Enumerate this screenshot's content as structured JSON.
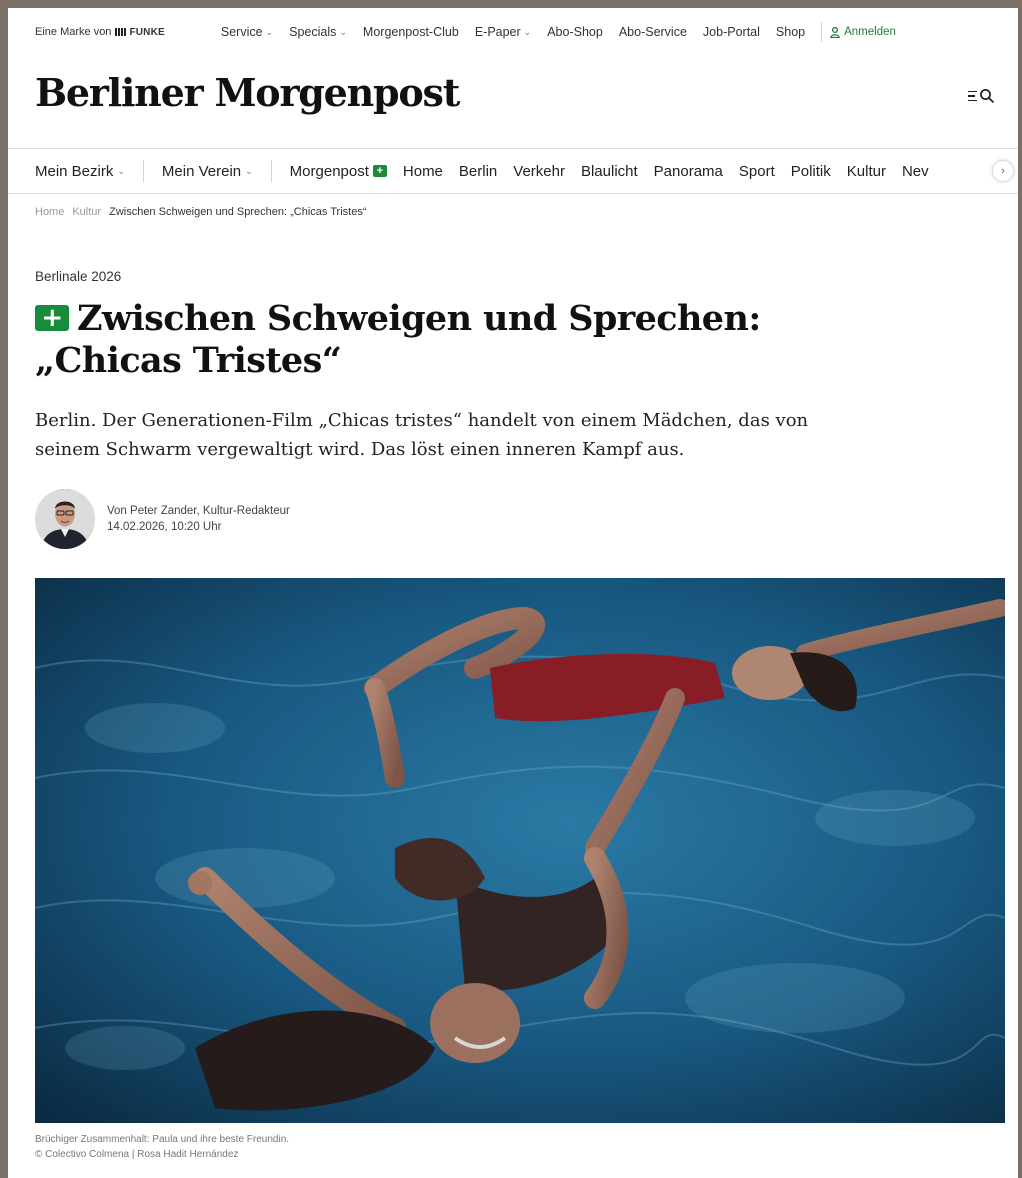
{
  "topbar": {
    "brand_note": "Eine Marke von",
    "brand_logo": "FUNKE",
    "nav": [
      {
        "label": "Service",
        "dropdown": true
      },
      {
        "label": "Specials",
        "dropdown": true
      },
      {
        "label": "Morgenpost-Club",
        "dropdown": false
      },
      {
        "label": "E-Paper",
        "dropdown": true
      },
      {
        "label": "Abo-Shop",
        "dropdown": false
      },
      {
        "label": "Abo-Service",
        "dropdown": false
      },
      {
        "label": "Job-Portal",
        "dropdown": false
      },
      {
        "label": "Shop",
        "dropdown": false
      }
    ],
    "login_label": "Anmelden",
    "login_icon": "user-icon"
  },
  "masthead": {
    "title": "Berliner Morgenpost",
    "menu_icon": "menu-search-icon"
  },
  "section_nav": {
    "bezirk": "Mein Bezirk",
    "verein": "Mein Verein",
    "plus_item": "Morgenpost",
    "items": [
      "Home",
      "Berlin",
      "Verkehr",
      "Blaulicht",
      "Panorama",
      "Sport",
      "Politik",
      "Kultur",
      "Nev"
    ],
    "scroll_icon": "chevron-right-icon"
  },
  "breadcrumb": {
    "items": [
      "Home",
      "Kultur",
      "Zwischen Schweigen und Sprechen: „Chicas Tristes“"
    ]
  },
  "article": {
    "kicker": "Berlinale 2026",
    "plus_glyph": "+",
    "headline": "Zwischen Schweigen und Sprechen: „Chicas Tristes“",
    "teaser": "Berlin. Der Generationen-Film „Chicas tristes“ handelt von einem Mädchen, das von seinem Schwarm vergewaltigt wird. Das löst einen inneren Kampf aus.",
    "author": "Von Peter Zander, Kultur-Redakteur",
    "date": "14.02.2026, 10:20 Uhr",
    "caption": "Brüchiger Zusammenhalt: Paula und ihre beste Freundin.",
    "credit": "© Colectivo Colmena | Rosa Hadit Hernández"
  },
  "colors": {
    "accent_green": "#1a8a3c",
    "pool_blue": "#1b5a80",
    "frame": "#7a7065"
  }
}
